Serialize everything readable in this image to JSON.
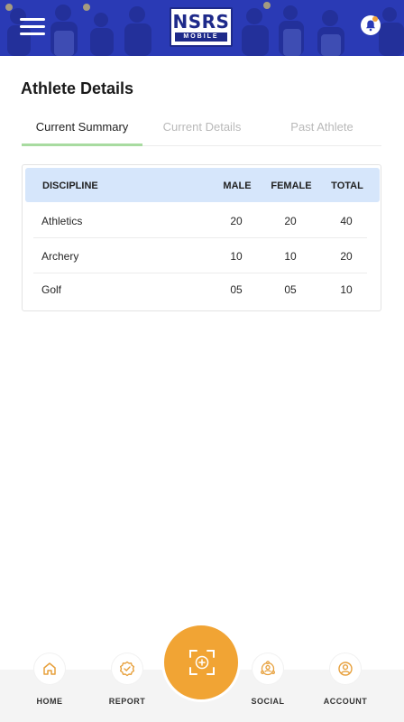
{
  "header": {
    "logo_main": "NSRS",
    "logo_sub": "MOBILE",
    "icons": {
      "menu": "hamburger-menu-icon",
      "bell": "notification-bell-icon"
    },
    "colors": {
      "header_bg": "#2a3ab5",
      "accent": "#f1a434",
      "tab_underline": "#a8dba0",
      "table_header_bg": "#d6e6fb"
    }
  },
  "page_title": "Athlete Details",
  "tabs": [
    {
      "label": "Current Summary",
      "active": true
    },
    {
      "label": "Current Details",
      "active": false
    },
    {
      "label": "Past Athlete",
      "active": false
    }
  ],
  "table": {
    "headers": {
      "discipline": "DISCIPLINE",
      "male": "MALE",
      "female": "FEMALE",
      "total": "TOTAL"
    },
    "rows": [
      {
        "discipline": "Athletics",
        "male": "20",
        "female": "20",
        "total": "40"
      },
      {
        "discipline": "Archery",
        "male": "10",
        "female": "10",
        "total": "20"
      },
      {
        "discipline": "Golf",
        "male": "05",
        "female": "05",
        "total": "10"
      }
    ]
  },
  "bottom_nav": {
    "home": {
      "label": "HOME",
      "icon": "home-icon"
    },
    "report": {
      "label": "REPORT",
      "icon": "report-badge-icon"
    },
    "scan": {
      "icon": "scan-plus-icon"
    },
    "social": {
      "label": "SOCIAL",
      "icon": "social-icon"
    },
    "account": {
      "label": "ACCOUNT",
      "icon": "account-icon"
    }
  }
}
